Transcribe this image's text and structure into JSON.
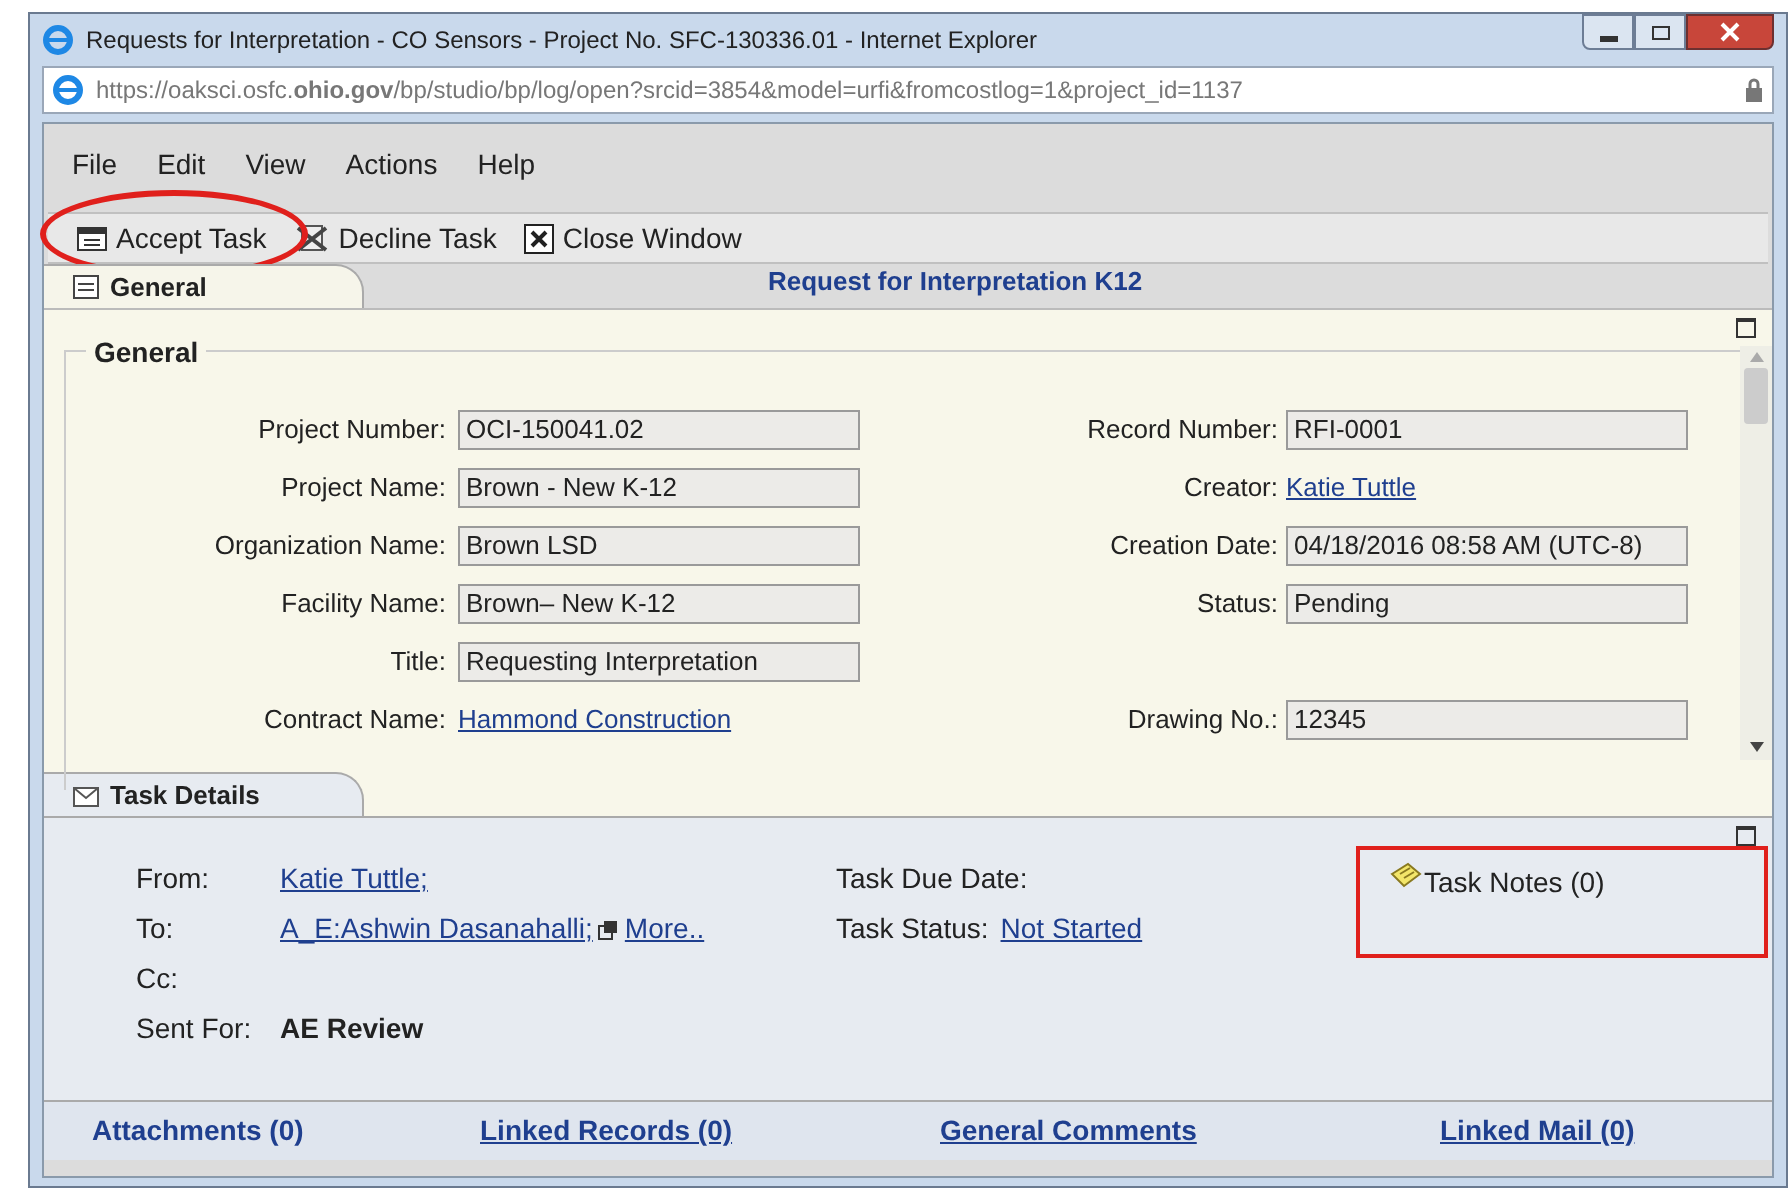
{
  "window": {
    "title": "Requests for Interpretation - CO Sensors - Project No. SFC-130336.01 - Internet Explorer"
  },
  "address": {
    "url": "https://oaksci.osfc.**ohio.gov**/bp/studio/bp/log/open?srcid=3854&model=urfi&fromcostlog=1&project_id=1137"
  },
  "menu": [
    "File",
    "Edit",
    "View",
    "Actions",
    "Help"
  ],
  "toolbar": [
    {
      "label": "Accept Task",
      "kind": "accept",
      "highlighted": true
    },
    {
      "label": "Decline Task",
      "kind": "decline",
      "highlighted": false
    },
    {
      "label": "Close Window",
      "kind": "close",
      "highlighted": false
    }
  ],
  "record_title": "Request for Interpretation K12",
  "general_tab": "General",
  "general_group": "General",
  "rows": [
    {
      "left": {
        "label": "Project Number:",
        "value": "OCI-150041.02",
        "kind": "field"
      },
      "right": {
        "label": "Record Number:",
        "value": "RFI-0001",
        "kind": "field"
      }
    },
    {
      "left": {
        "label": "Project Name:",
        "value": "Brown - New K-12",
        "kind": "field"
      },
      "right": {
        "label": "Creator:",
        "value": "Katie Tuttle",
        "kind": "link"
      }
    },
    {
      "left": {
        "label": "Organization Name:",
        "value": "Brown LSD",
        "kind": "field"
      },
      "right": {
        "label": "Creation Date:",
        "value": "04/18/2016 08:58 AM (UTC-8)",
        "kind": "field"
      }
    },
    {
      "left": {
        "label": "Facility Name:",
        "value": "Brown– New K-12",
        "kind": "field"
      },
      "right": {
        "label": "Status:",
        "value": "Pending",
        "kind": "field"
      }
    },
    {
      "left": {
        "label": "Title:",
        "value": "Requesting Interpretation",
        "kind": "field"
      }
    },
    {
      "left": {
        "label": "Contract Name:",
        "value": "Hammond Construction",
        "kind": "link"
      },
      "right": {
        "label": "Drawing No.:",
        "value": "12345",
        "kind": "field"
      }
    }
  ],
  "task_tab": "Task Details",
  "task": {
    "from_label": "From:",
    "from": "Katie Tuttle;",
    "to_label": "To:",
    "to": "A_E:Ashwin Dasanahalli;",
    "more": "More..",
    "cc_label": "Cc:",
    "sent_for_label": "Sent For:",
    "sent_for": "AE Review",
    "due_label": "Task Due Date:",
    "status_label": "Task Status:",
    "status": "Not Started",
    "notes": "Task Notes (0)",
    "notes_highlighted": true
  },
  "bottom_links": [
    {
      "label": "Attachments (0)",
      "kind": "plain"
    },
    {
      "label": "Linked Records (0)",
      "kind": "link"
    },
    {
      "label": "General Comments",
      "kind": "link"
    },
    {
      "label": "Linked Mail (0)",
      "kind": "link"
    }
  ]
}
